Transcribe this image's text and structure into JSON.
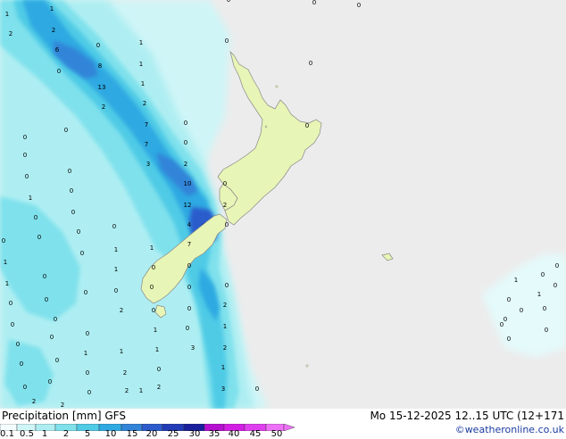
{
  "footer": {
    "title": "Precipitation [mm] GFS",
    "datetime": "Mo 15-12-2025 12..15 UTC (12+171",
    "credit": "©weatheronline.co.uk"
  },
  "legend": {
    "ticks": [
      "0.1",
      "0.5",
      "1",
      "2",
      "5",
      "10",
      "15",
      "20",
      "25",
      "30",
      "35",
      "40",
      "45",
      "50"
    ],
    "colors": [
      "#f5fefe",
      "#cff5f7",
      "#aeeef2",
      "#7fe1ec",
      "#4fcbe6",
      "#2fa9e2",
      "#3184d8",
      "#2c5bcc",
      "#223bb6",
      "#1a1f9c",
      "#b50fd0",
      "#d31ee4",
      "#e03ff0",
      "#ee70f8"
    ]
  },
  "map": {
    "ocean_color": "#ececec",
    "land_color": "#e7f5b6",
    "precip_values": [
      "1",
      "1",
      "2",
      "2",
      "6",
      "0",
      "8",
      "0",
      "13",
      "2",
      "1",
      "1",
      "2",
      "1",
      "0",
      "7",
      "0",
      "7",
      "0",
      "3",
      "2",
      "0",
      "10",
      "0",
      "12",
      "2",
      "4",
      "0",
      "7",
      "0",
      "0",
      "0",
      "0",
      "0",
      "0",
      "0",
      "0",
      "0",
      "0",
      "0",
      "0",
      "0",
      "0",
      "0",
      "0",
      "1",
      "1",
      "1",
      "1",
      "1",
      "1",
      "0",
      "0",
      "0",
      "0",
      "0",
      "0",
      "0",
      "0",
      "0",
      "0",
      "0",
      "2",
      "0",
      "0",
      "0",
      "0",
      "0",
      "0",
      "1",
      "1",
      "0",
      "0",
      "2",
      "1",
      "0",
      "0",
      "1",
      "0",
      "0",
      "1",
      "0",
      "2",
      "0",
      "2",
      "0",
      "1",
      "0",
      "3",
      "3",
      "1",
      "2",
      "2",
      "2",
      "2",
      "0",
      "0",
      "1",
      "1",
      "0",
      "0",
      "0",
      "0",
      "0",
      "0",
      "0",
      "0",
      "0"
    ]
  }
}
